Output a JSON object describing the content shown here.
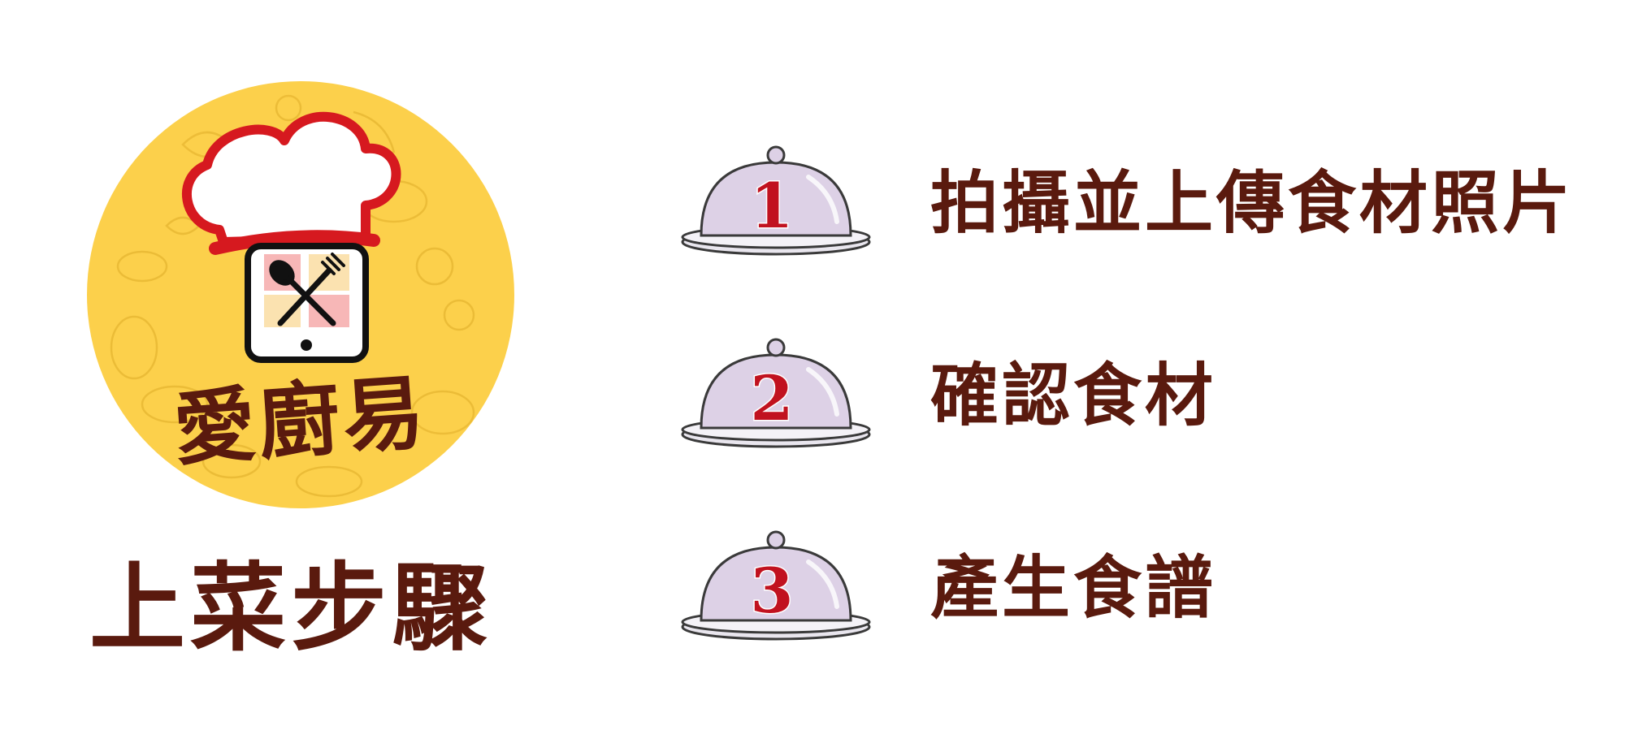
{
  "colors": {
    "brand_yellow": "#fcd04b",
    "brown_text": "#5a1a0e",
    "chef_red": "#d6191f",
    "number_red": "#c1121f",
    "cloche_lavender": "#ddd1e6"
  },
  "logo": {
    "brand_text": "愛廚易",
    "icons": [
      "chef-hat-icon",
      "phone-icon",
      "spoon-fork-icon"
    ]
  },
  "heading": "上菜步驟",
  "steps": [
    {
      "number": "1",
      "label": "拍攝並上傳食材照片",
      "icon": "cloche-icon"
    },
    {
      "number": "2",
      "label": "確認食材",
      "icon": "cloche-icon"
    },
    {
      "number": "3",
      "label": "產生食譜",
      "icon": "cloche-icon"
    }
  ]
}
